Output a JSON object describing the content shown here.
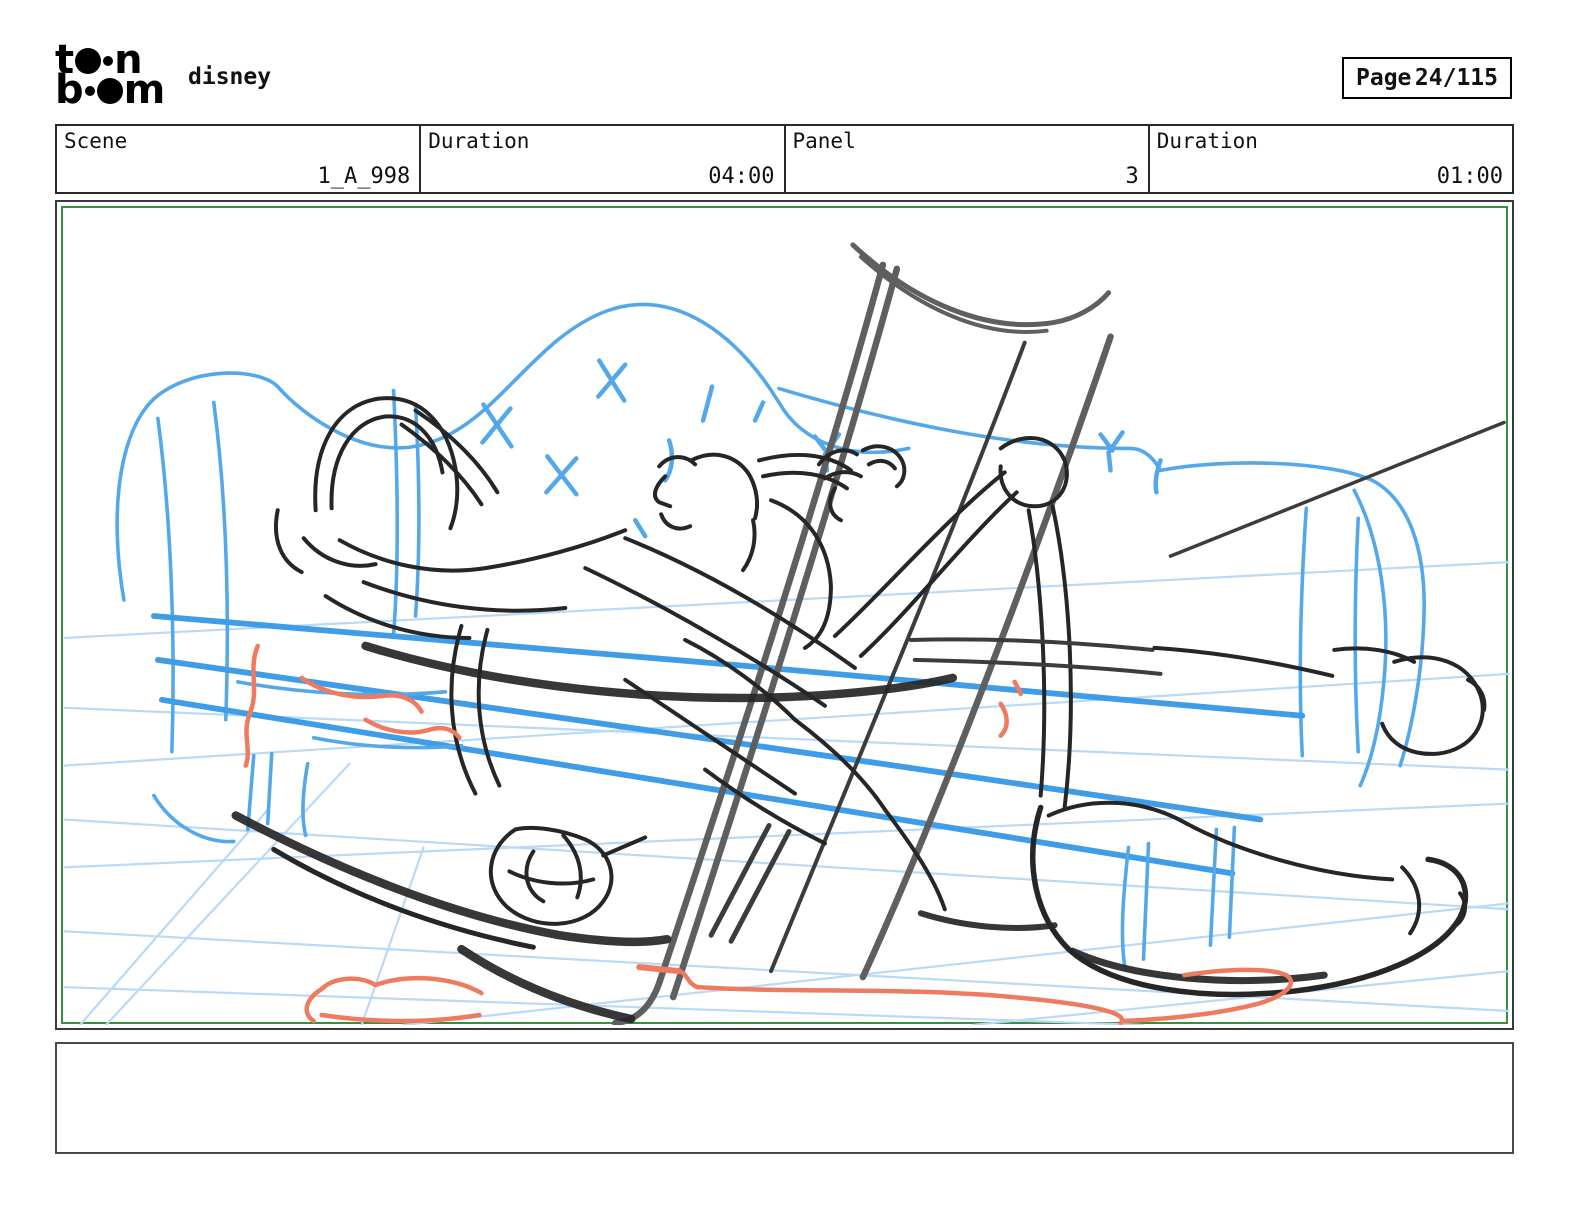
{
  "header": {
    "logo": {
      "line1_start": "t",
      "line1_end": "n",
      "line2_start": "b",
      "line2_end": "m"
    },
    "project_title": "disney",
    "page": {
      "label": "Page",
      "value": "24/115"
    }
  },
  "info_bar": {
    "cells": [
      {
        "label": "Scene",
        "value": "1_A_998"
      },
      {
        "label": "Duration",
        "value": "04:00"
      },
      {
        "label": "Panel",
        "value": "3"
      },
      {
        "label": "Duration",
        "value": "01:00"
      }
    ]
  },
  "panel": {
    "caption_text": "",
    "description": "rough storyboard sketch: character sprawled on a couch holding a pole"
  },
  "colors": {
    "green": "#35923c",
    "couch": "#54a8ea",
    "couch-strong": "#3f9ce6",
    "floor": "#b9d9f5",
    "ink": "#262626",
    "ink2": "#3c3c3c",
    "pole": "#5f5f5f",
    "accent": "#ee7a60"
  }
}
